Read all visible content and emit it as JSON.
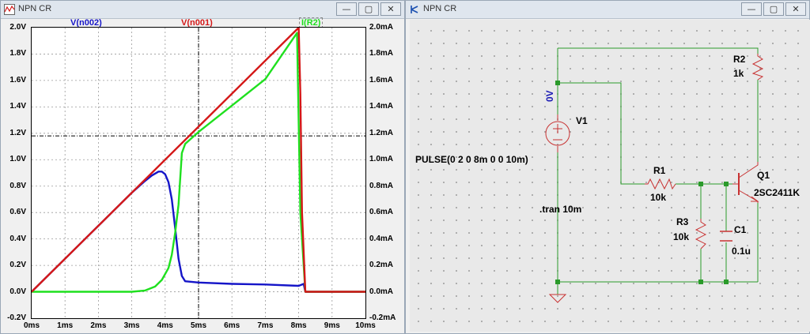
{
  "plot_window": {
    "title": "NPN CR",
    "controls": {
      "min": "—",
      "max": "▢",
      "close": "✕"
    },
    "trace_labels": {
      "v_n002": "V(n002)",
      "v_n001": "V(n001)",
      "i_r2": "I(R2)"
    },
    "colors": {
      "v_n002": "#1515c8",
      "v_n001": "#d41818",
      "i_r2": "#1fe01f"
    },
    "y_left_ticks": [
      "2.0V",
      "1.8V",
      "1.6V",
      "1.4V",
      "1.2V",
      "1.0V",
      "0.8V",
      "0.6V",
      "0.4V",
      "0.2V",
      "0.0V",
      "-0.2V"
    ],
    "y_right_ticks": [
      "2.0mA",
      "1.8mA",
      "1.6mA",
      "1.4mA",
      "1.2mA",
      "1.0mA",
      "0.8mA",
      "0.6mA",
      "0.4mA",
      "0.2mA",
      "0.0mA",
      "-0.2mA"
    ],
    "x_ticks": [
      "0ms",
      "1ms",
      "2ms",
      "3ms",
      "4ms",
      "5ms",
      "6ms",
      "7ms",
      "8ms",
      "9ms",
      "10ms"
    ]
  },
  "chart_data": {
    "type": "line",
    "xlabel": "",
    "ylabel": "",
    "xlim": [
      0,
      10
    ],
    "ylim": [
      -0.2,
      2.0
    ],
    "y2lim": [
      -0.2,
      2.0
    ],
    "grid": true,
    "cursor": {
      "x": 5.0,
      "y": 1.18
    },
    "series": [
      {
        "name": "V(n001)",
        "axis": "left",
        "x": [
          0,
          8.0,
          8.05,
          8.1,
          8.2,
          10
        ],
        "y": [
          0,
          2.0,
          1.5,
          0.6,
          0.0,
          0.0
        ]
      },
      {
        "name": "V(n002)",
        "axis": "left",
        "x": [
          0,
          1,
          2,
          3,
          3.4,
          3.6,
          3.8,
          3.9,
          4.0,
          4.1,
          4.2,
          4.3,
          4.4,
          4.5,
          4.6,
          5,
          6,
          7,
          8.0,
          8.15,
          8.2,
          10
        ],
        "y": [
          0,
          0.25,
          0.5,
          0.75,
          0.84,
          0.88,
          0.91,
          0.91,
          0.89,
          0.83,
          0.7,
          0.48,
          0.25,
          0.12,
          0.08,
          0.07,
          0.06,
          0.055,
          0.045,
          0.06,
          0.0,
          0.0
        ]
      },
      {
        "name": "I(R2)",
        "axis": "right",
        "x": [
          0,
          3.0,
          3.4,
          3.7,
          3.9,
          4.1,
          4.2,
          4.3,
          4.4,
          4.5,
          4.6,
          5,
          6,
          7,
          7.95,
          8.05,
          8.2,
          10
        ],
        "y": [
          0,
          0.0,
          0.01,
          0.04,
          0.09,
          0.18,
          0.28,
          0.45,
          0.66,
          1.05,
          1.12,
          1.21,
          1.41,
          1.61,
          1.96,
          0.6,
          0.0,
          0.0
        ]
      }
    ]
  },
  "schematic_window": {
    "title": "NPN CR",
    "controls": {
      "min": "—",
      "max": "▢",
      "close": "✕"
    },
    "labels": {
      "v1_value": "0V",
      "v1_name": "V1",
      "pulse": "PULSE(0 2 0 8m 0 0 10m)",
      "tran": ".tran 10m",
      "r1_name": "R1",
      "r1_value": "10k",
      "r2_name": "R2",
      "r2_value": "1k",
      "r3_name": "R3",
      "r3_value": "10k",
      "c1_name": "C1",
      "c1_value": "0.1u",
      "q1_name": "Q1",
      "q1_model": "2SC2411K"
    }
  }
}
